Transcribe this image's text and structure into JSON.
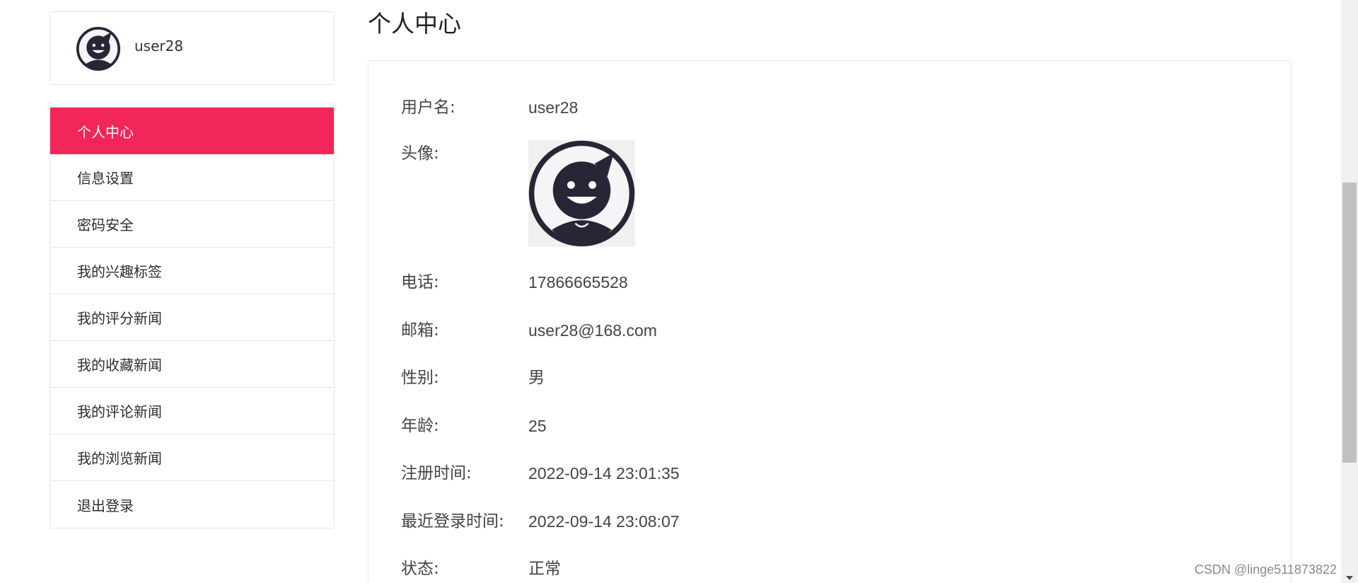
{
  "profile": {
    "username": "user28"
  },
  "menu": {
    "items": [
      {
        "label": "个人中心",
        "active": true
      },
      {
        "label": "信息设置"
      },
      {
        "label": "密码安全"
      },
      {
        "label": "我的兴趣标签"
      },
      {
        "label": "我的评分新闻"
      },
      {
        "label": "我的收藏新闻"
      },
      {
        "label": "我的评论新闻"
      },
      {
        "label": "我的浏览新闻"
      },
      {
        "label": "退出登录"
      }
    ]
  },
  "main": {
    "title": "个人中心",
    "fields": {
      "username": {
        "label": "用户名:",
        "value": "user28"
      },
      "avatar": {
        "label": "头像:"
      },
      "phone": {
        "label": "电话:",
        "value": "17866665528"
      },
      "email": {
        "label": "邮箱:",
        "value": "user28@168.com"
      },
      "gender": {
        "label": "性别:",
        "value": "男"
      },
      "age": {
        "label": "年龄:",
        "value": "25"
      },
      "register_time": {
        "label": "注册时间:",
        "value": "2022-09-14 23:01:35"
      },
      "last_login": {
        "label": "最近登录时间:",
        "value": "2022-09-14 23:08:07"
      },
      "status": {
        "label": "状态:",
        "value": "正常"
      }
    }
  },
  "watermark": "CSDN @linge511873822",
  "colors": {
    "accent": "#f3265a",
    "avatar": "#262637"
  },
  "icons": {
    "avatar": "smiley-avatar-icon"
  }
}
